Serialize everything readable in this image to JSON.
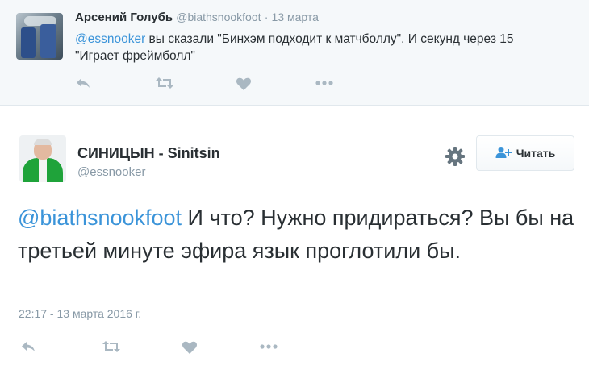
{
  "reply_tweet": {
    "author_name": "Арсений Голубь",
    "author_handle": "@biathsnookfoot",
    "separator": "·",
    "date": "13 марта",
    "mention": "@essnooker",
    "text_line1": " вы сказали \"Бинхэм подходит к матчболлу\". И секунд через 15",
    "text_line2": "\"Играет фреймболл\"",
    "actions": [
      "reply-icon",
      "retweet-icon",
      "like-icon",
      "more-icon"
    ]
  },
  "main_tweet": {
    "author_name": "СИНИЦЫН - Sinitsin",
    "author_handle": "@essnooker",
    "follow_label": "Читать",
    "mention": "@biathsnookfoot",
    "text": " И что? Нужно придираться? Вы бы на третьей минуте эфира язык проглотили бы.",
    "timestamp": "22:17 - 13 марта 2016 г.",
    "actions": [
      "reply-icon",
      "retweet-icon",
      "like-icon",
      "more-icon"
    ]
  },
  "colors": {
    "link": "#3b94d9",
    "muted": "#8899a6",
    "icon": "#aab8c2",
    "text": "#292f33"
  }
}
